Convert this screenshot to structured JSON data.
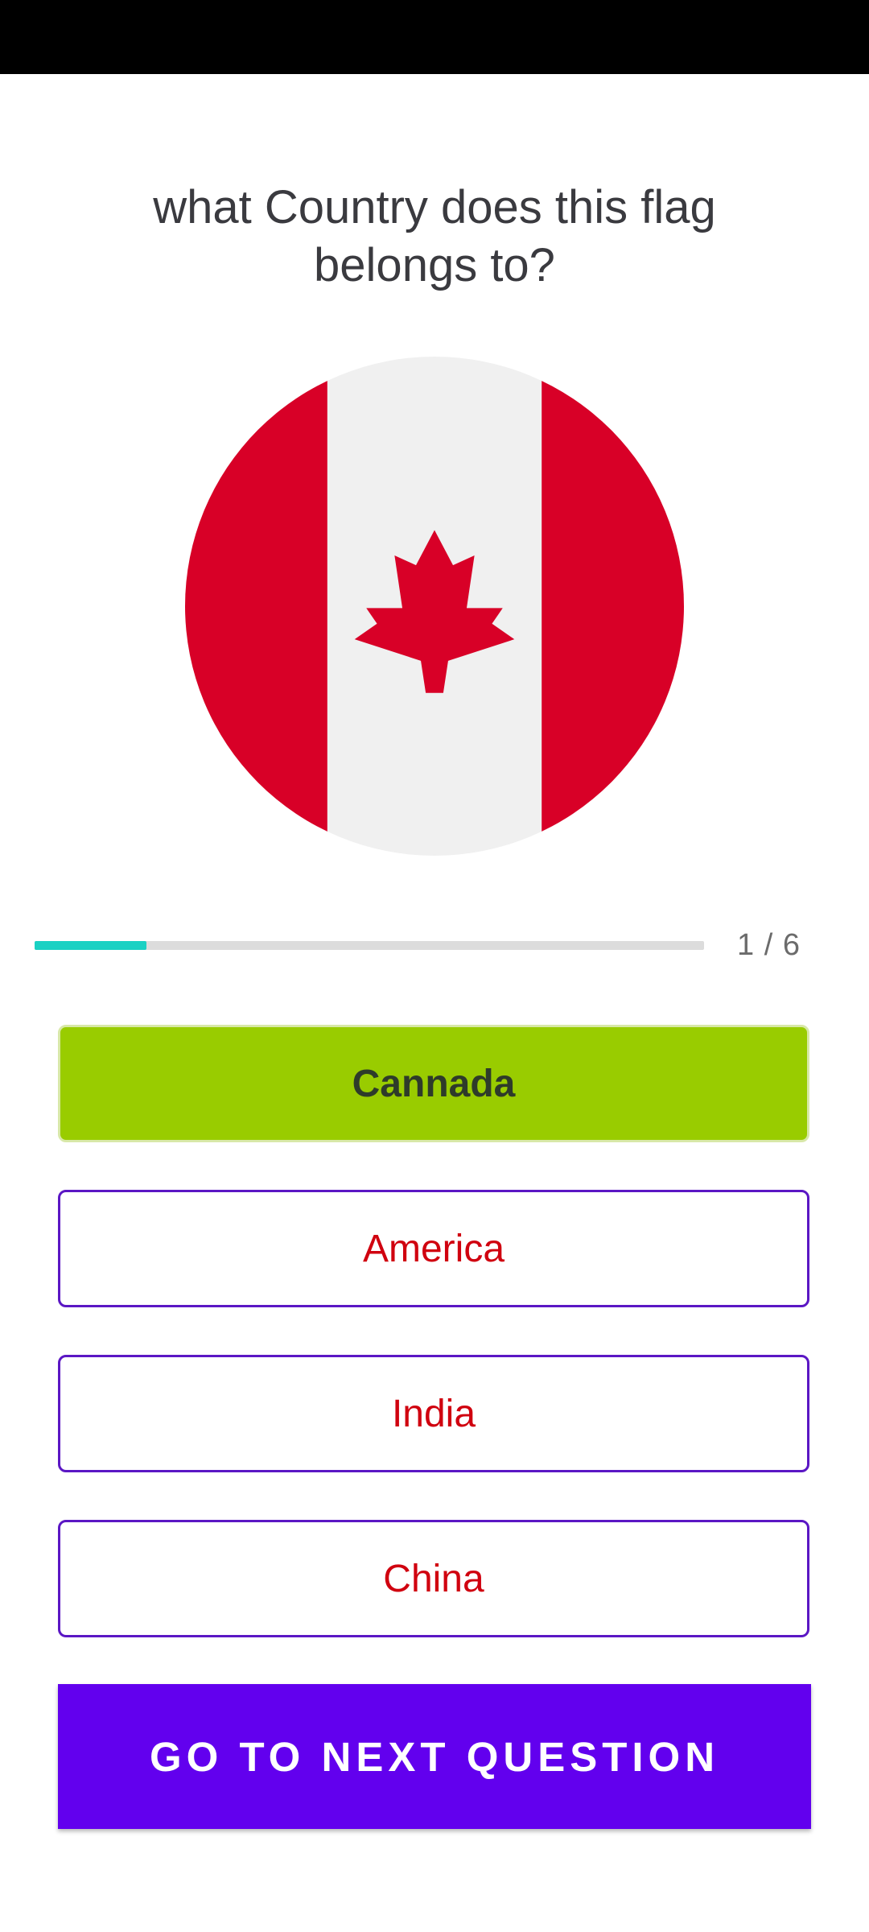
{
  "quiz": {
    "question": "what Country does this flag belongs to?",
    "flag": {
      "icon": "canada-flag-icon",
      "colors": {
        "red": "#d80027",
        "white": "#f0f0f0"
      }
    },
    "progress": {
      "current": 1,
      "total": 6,
      "label": "1 / 6",
      "fill_fraction": 0.167,
      "fill_color": "#1ad1c3",
      "track_color": "#dcdcdc"
    },
    "options": [
      {
        "label": "Cannada",
        "state": "selected"
      },
      {
        "label": "America",
        "state": "default"
      },
      {
        "label": "India",
        "state": "default"
      },
      {
        "label": "China",
        "state": "default"
      }
    ],
    "next_button": {
      "label": "GO TO NEXT QUESTION",
      "color": "#6200ee"
    }
  }
}
